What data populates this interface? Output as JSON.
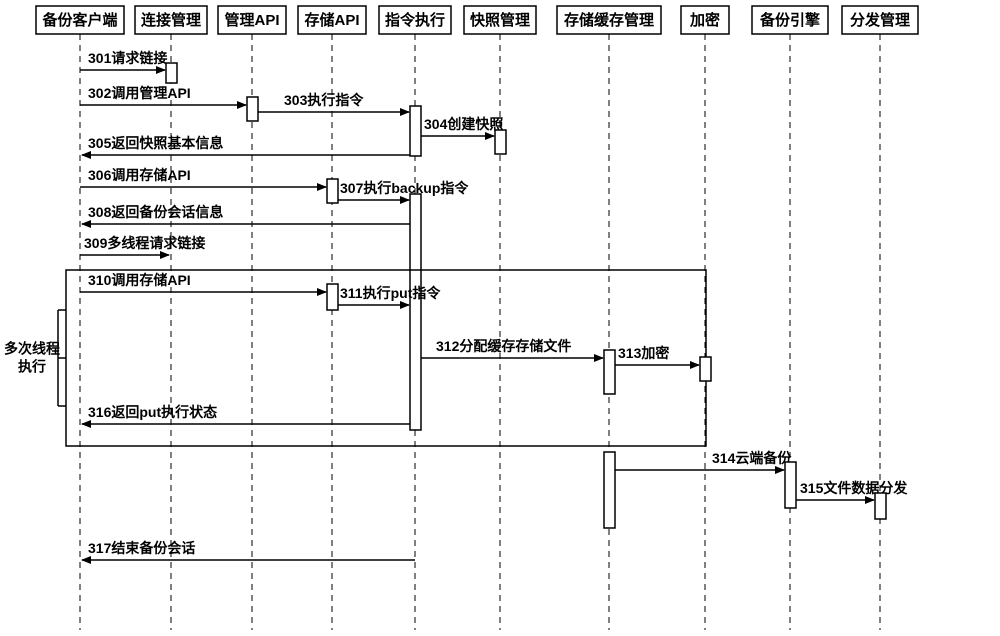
{
  "participants": [
    {
      "id": "client",
      "label": "备份客户端"
    },
    {
      "id": "conn",
      "label": "连接管理"
    },
    {
      "id": "mgmtapi",
      "label": "管理API"
    },
    {
      "id": "storeapi",
      "label": "存储API"
    },
    {
      "id": "cmd",
      "label": "指令执行"
    },
    {
      "id": "snap",
      "label": "快照管理"
    },
    {
      "id": "cache",
      "label": "存储缓存管理"
    },
    {
      "id": "enc",
      "label": "加密"
    },
    {
      "id": "engine",
      "label": "备份引擎"
    },
    {
      "id": "dist",
      "label": "分发管理"
    }
  ],
  "messages": {
    "m301": "301请求链接",
    "m302": "302调用管理API",
    "m303": "303执行指令",
    "m304": "304创建快照",
    "m305": "305返回快照基本信息",
    "m306": "306调用存储API",
    "m307": "307执行backup指令",
    "m308": "308返回备份会话信息",
    "m309": "309多线程请求链接",
    "m310": "310调用存储API",
    "m311": "311执行put指令",
    "m312": "312分配缓存存储文件",
    "m313": "313加密",
    "m314": "314云端备份",
    "m315": "315文件数据分发",
    "m316": "316返回put执行状态",
    "m317": "317结束备份会话"
  },
  "fragment_label": "多次线程\n执行",
  "chart_data": {
    "type": "sequence-diagram",
    "participants": [
      "备份客户端",
      "连接管理",
      "管理API",
      "存储API",
      "指令执行",
      "快照管理",
      "存储缓存管理",
      "加密",
      "备份引擎",
      "分发管理"
    ],
    "interactions": [
      {
        "step": 301,
        "from": "备份客户端",
        "to": "连接管理",
        "text": "请求链接"
      },
      {
        "step": 302,
        "from": "备份客户端",
        "to": "管理API",
        "text": "调用管理API"
      },
      {
        "step": 303,
        "from": "管理API",
        "to": "指令执行",
        "text": "执行指令"
      },
      {
        "step": 304,
        "from": "指令执行",
        "to": "快照管理",
        "text": "创建快照"
      },
      {
        "step": 305,
        "from": "指令执行",
        "to": "备份客户端",
        "text": "返回快照基本信息"
      },
      {
        "step": 306,
        "from": "备份客户端",
        "to": "存储API",
        "text": "调用存储API"
      },
      {
        "step": 307,
        "from": "存储API",
        "to": "指令执行",
        "text": "执行backup指令"
      },
      {
        "step": 308,
        "from": "指令执行",
        "to": "备份客户端",
        "text": "返回备份会话信息"
      },
      {
        "step": 309,
        "from": "备份客户端",
        "to": "连接管理",
        "text": "多线程请求链接"
      },
      {
        "step": 310,
        "from": "备份客户端",
        "to": "存储API",
        "text": "调用存储API",
        "fragment": "多次线程执行"
      },
      {
        "step": 311,
        "from": "存储API",
        "to": "指令执行",
        "text": "执行put指令",
        "fragment": "多次线程执行"
      },
      {
        "step": 312,
        "from": "指令执行",
        "to": "存储缓存管理",
        "text": "分配缓存存储文件",
        "fragment": "多次线程执行"
      },
      {
        "step": 313,
        "from": "存储缓存管理",
        "to": "加密",
        "text": "加密",
        "fragment": "多次线程执行"
      },
      {
        "step": 314,
        "from": "存储缓存管理",
        "to": "备份引擎",
        "text": "云端备份"
      },
      {
        "step": 315,
        "from": "备份引擎",
        "to": "分发管理",
        "text": "文件数据分发"
      },
      {
        "step": 316,
        "from": "指令执行",
        "to": "备份客户端",
        "text": "返回put执行状态",
        "fragment": "多次线程执行"
      },
      {
        "step": 317,
        "from": "指令执行",
        "to": "备份客户端",
        "text": "结束备份会话"
      }
    ],
    "fragment": {
      "label": "多次线程执行",
      "steps": [
        310,
        311,
        312,
        313,
        316
      ]
    }
  }
}
